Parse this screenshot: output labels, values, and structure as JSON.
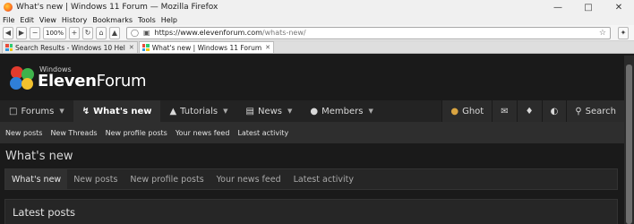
{
  "window": {
    "title": "What's new | Windows 11 Forum — Mozilla Firefox"
  },
  "menu": [
    "File",
    "Edit",
    "View",
    "History",
    "Bookmarks",
    "Tools",
    "Help"
  ],
  "toolbar": {
    "zoom": "100%",
    "zoom_minus": "−",
    "zoom_plus": "+"
  },
  "url": {
    "host": "https://www.elevenforum.com",
    "path": "/whats-new/"
  },
  "tabs": [
    {
      "label": "Search Results - Windows 10 Hel",
      "active": false
    },
    {
      "label": "What's new | Windows 11 Forum",
      "active": true
    }
  ],
  "logo": {
    "small": "Windows",
    "brand_a": "Eleven",
    "brand_b": "Forum"
  },
  "mainnav": {
    "items": [
      {
        "label": "Forums",
        "icon": "chat-icon",
        "caret": true
      },
      {
        "label": "What's new",
        "icon": "bolt-icon",
        "caret": true,
        "active": true
      },
      {
        "label": "Tutorials",
        "icon": "graduation-cap-icon",
        "caret": true
      },
      {
        "label": "News",
        "icon": "newspaper-icon",
        "caret": true
      },
      {
        "label": "Members",
        "icon": "users-icon",
        "caret": true
      }
    ],
    "user": "Ghot",
    "search": "Search"
  },
  "subnav": [
    "New posts",
    "New Threads",
    "New profile posts",
    "Your news feed",
    "Latest activity"
  ],
  "page": {
    "title": "What's new"
  },
  "content_tabs": [
    "What's new",
    "New posts",
    "New profile posts",
    "Your news feed",
    "Latest activity"
  ],
  "latest": {
    "heading": "Latest posts"
  },
  "colors": {
    "site_bg": "#1a1a1a",
    "nav_bg": "#232323",
    "subnav_bg": "#2e2e2e"
  }
}
